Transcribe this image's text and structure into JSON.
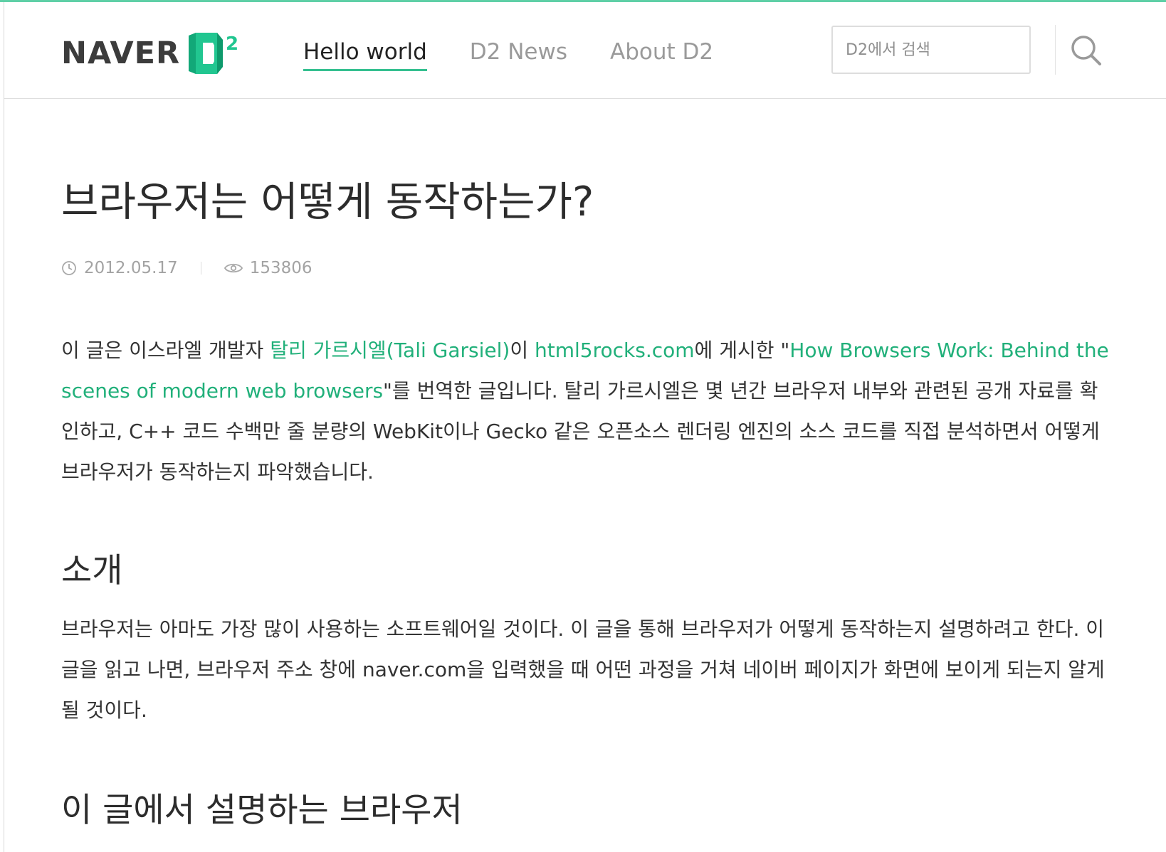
{
  "brand": {
    "wordmark": "NAVER",
    "mark_letter": "D",
    "mark_superscript": "2",
    "accent_color": "#36c090",
    "link_color": "#21b07a"
  },
  "nav": {
    "items": [
      {
        "label": "Hello world",
        "active": true
      },
      {
        "label": "D2 News",
        "active": false
      },
      {
        "label": "About D2",
        "active": false
      }
    ]
  },
  "search": {
    "placeholder": "D2에서 검색",
    "value": "",
    "icon": "search-icon"
  },
  "article": {
    "title": "브라우저는 어떻게 동작하는가?",
    "date": "2012.05.17",
    "views": "153806",
    "date_icon": "clock-icon",
    "views_icon": "eye-icon",
    "intro": {
      "t1": "이 글은 이스라엘 개발자 ",
      "link_author": "탈리 가르시엘(Tali Garsiel)",
      "t2": "이 ",
      "link_site": "html5rocks.com",
      "t3": "에 게시한 \"",
      "link_article": "How Browsers Work: Behind the scenes of modern web browsers",
      "t4": "\"를 번역한 글입니다. 탈리 가르시엘은 몇 년간 브라우저 내부와 관련된 공개 자료를 확인하고, C++ 코드 수백만 줄 분량의 WebKit이나 Gecko 같은 오픈소스 렌더링 엔진의 소스 코드를 직접 분석하면서 어떻게 브라우저가 동작하는지 파악했습니다."
    },
    "section_intro_heading": "소개",
    "section_intro_body": "브라우저는 아마도 가장 많이 사용하는 소프트웨어일 것이다. 이 글을 통해 브라우저가 어떻게 동작하는지 설명하려고 한다. 이 글을 읽고 나면, 브라우저 주소 창에 naver.com을 입력했을 때 어떤 과정을 거쳐 네이버 페이지가 화면에 보이게 되는지 알게 될 것이다.",
    "section_browsers_heading": "이 글에서 설명하는 브라우저"
  }
}
